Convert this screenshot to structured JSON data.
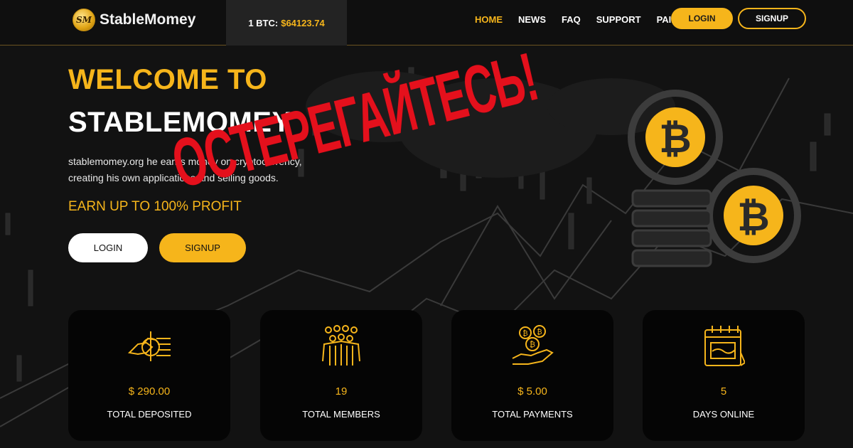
{
  "header": {
    "logo_mark": "SM",
    "logo_text": "StableMomey",
    "btc_label": "1 BTC:",
    "btc_value": "$64123.74",
    "nav": [
      {
        "label": "HOME",
        "active": true
      },
      {
        "label": "NEWS",
        "active": false
      },
      {
        "label": "FAQ",
        "active": false
      },
      {
        "label": "SUPPORT",
        "active": false
      },
      {
        "label": "PAID",
        "active": false
      }
    ],
    "login_label": "LOGIN",
    "signup_label": "SIGNUP"
  },
  "hero": {
    "title_line1": "WELCOME TO",
    "title_line2": "STABLEMOMEY",
    "description": "stablemomey.org he earns money on cryptocurrency, creating his own applications and selling goods.",
    "earn_text": "EARN UP TO 100% PROFIT",
    "login_label": "LOGIN",
    "signup_label": "SIGNUP"
  },
  "stats": [
    {
      "icon": "handshake-icon",
      "value": "$ 290.00",
      "label": "TOTAL DEPOSITED"
    },
    {
      "icon": "members-icon",
      "value": "19",
      "label": "TOTAL MEMBERS"
    },
    {
      "icon": "bitcoin-hand-icon",
      "value": "$ 5.00",
      "label": "TOTAL PAYMENTS"
    },
    {
      "icon": "calendar-icon",
      "value": "5",
      "label": "DAYS ONLINE"
    }
  ],
  "overlay": {
    "warning_text": "ОСТЕРЕГАЙТЕСЬ!"
  },
  "colors": {
    "accent": "#f6b51b",
    "background": "#121212",
    "warning": "#e4101c"
  }
}
